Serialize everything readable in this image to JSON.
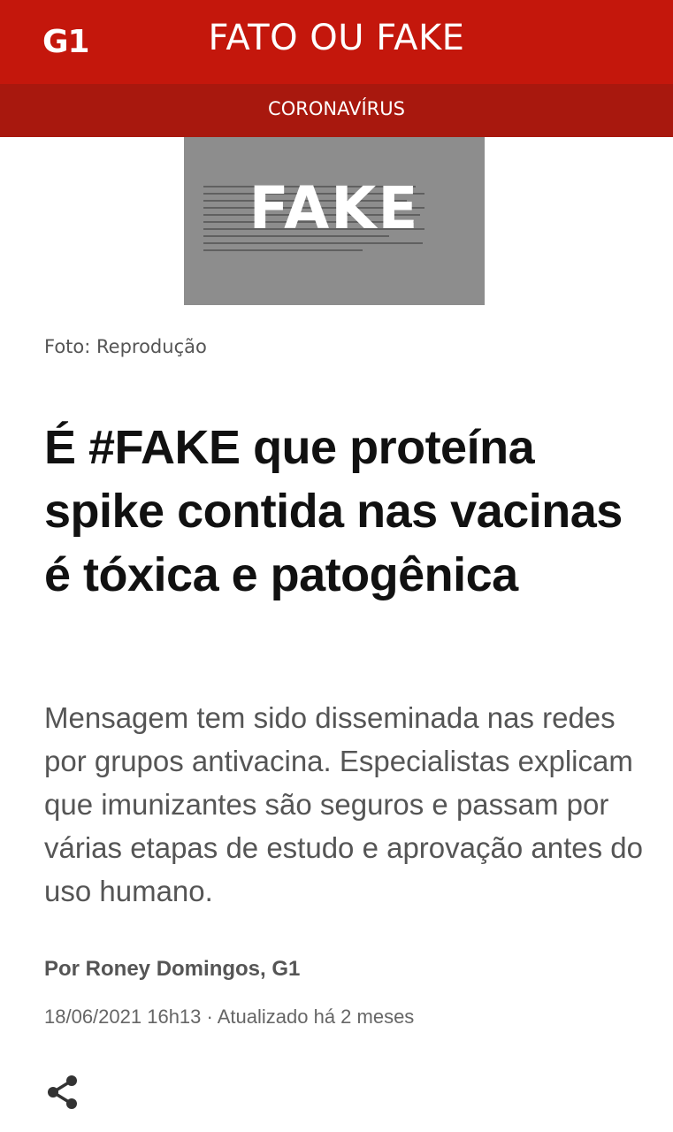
{
  "header": {
    "logo": "G1",
    "title": "FATO OU FAKE",
    "brand_color": "#c4170c"
  },
  "subnav": {
    "label": "CORONAVÍRUS",
    "color": "#a8180e"
  },
  "hero": {
    "stamp": "FAKE",
    "background": "#8d8d8d"
  },
  "article": {
    "photo_caption": "Foto: Reprodução",
    "headline": "É #FAKE que proteína spike contida nas vacinas é tóxica e patogênica",
    "summary": "Mensagem tem sido disseminada nas redes por grupos antivacina. Especialistas explicam que imunizantes são seguros e passam por várias etapas de estudo e aprovação antes do uso humano.",
    "byline": "Por Roney Domingos, G1",
    "timestamp": "18/06/2021 16h13 · Atualizado há 2 meses"
  },
  "actions": {
    "share_icon": "share-icon"
  }
}
